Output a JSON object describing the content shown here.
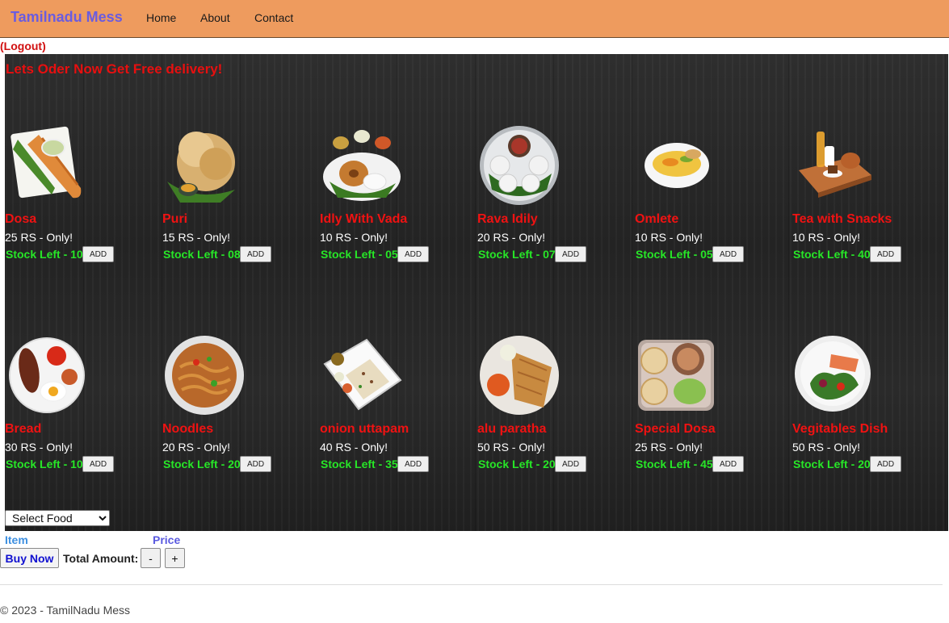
{
  "navbar": {
    "brand": "Tamilnadu Mess",
    "links": [
      "Home",
      "About",
      "Contact"
    ],
    "background": "#ee9b5e"
  },
  "logout_label": "(Logout)",
  "promo_text": "Lets Oder Now Get Free delivery!",
  "add_label": "ADD",
  "foods": [
    {
      "name": "Dosa",
      "price": "25 RS - Only!",
      "stock": "Stock Left - 10",
      "icon": "dosa-icon"
    },
    {
      "name": "Puri",
      "price": "15 RS - Only!",
      "stock": "Stock Left - 08",
      "icon": "puri-icon"
    },
    {
      "name": "Idly With Vada",
      "price": "10 RS - Only!",
      "stock": "Stock Left - 05",
      "icon": "idly-vada-icon"
    },
    {
      "name": "Rava Idily",
      "price": "20 RS - Only!",
      "stock": "Stock Left - 07",
      "icon": "rava-idly-icon"
    },
    {
      "name": "Omlete",
      "price": "10 RS - Only!",
      "stock": "Stock Left - 05",
      "icon": "omelette-icon"
    },
    {
      "name": "Tea with Snacks",
      "price": "10 RS - Only!",
      "stock": "Stock Left - 40",
      "icon": "tea-snacks-icon"
    },
    {
      "name": "Bread",
      "price": "30 RS - Only!",
      "stock": "Stock Left - 10",
      "icon": "bread-icon"
    },
    {
      "name": "Noodles",
      "price": "20 RS - Only!",
      "stock": "Stock Left - 20",
      "icon": "noodles-icon"
    },
    {
      "name": "onion uttapam",
      "price": "40 RS - Only!",
      "stock": "Stock Left - 35",
      "icon": "uttapam-icon"
    },
    {
      "name": "alu paratha",
      "price": "50 RS - Only!",
      "stock": "Stock Left - 20",
      "icon": "paratha-icon"
    },
    {
      "name": "Special Dosa",
      "price": "25 RS - Only!",
      "stock": "Stock Left - 45",
      "icon": "special-dosa-icon"
    },
    {
      "name": "Vegitables Dish",
      "price": "50 RS - Only!",
      "stock": "Stock Left - 20",
      "icon": "vegetable-dish-icon"
    }
  ],
  "order": {
    "select_placeholder": "Select Food",
    "item_header": "Item",
    "price_header": "Price",
    "buy_now": "Buy Now",
    "total_label": "Total Amount:",
    "minus": "-",
    "plus": "+"
  },
  "footer": "© 2023 - TamilNadu Mess",
  "colors": {
    "food_name": "#f01212",
    "stock": "#27e627",
    "promo": "#e80f0f",
    "brand": "#6a5ce0",
    "item_header": "#3d8fe0",
    "price_header": "#5a5ae0"
  }
}
